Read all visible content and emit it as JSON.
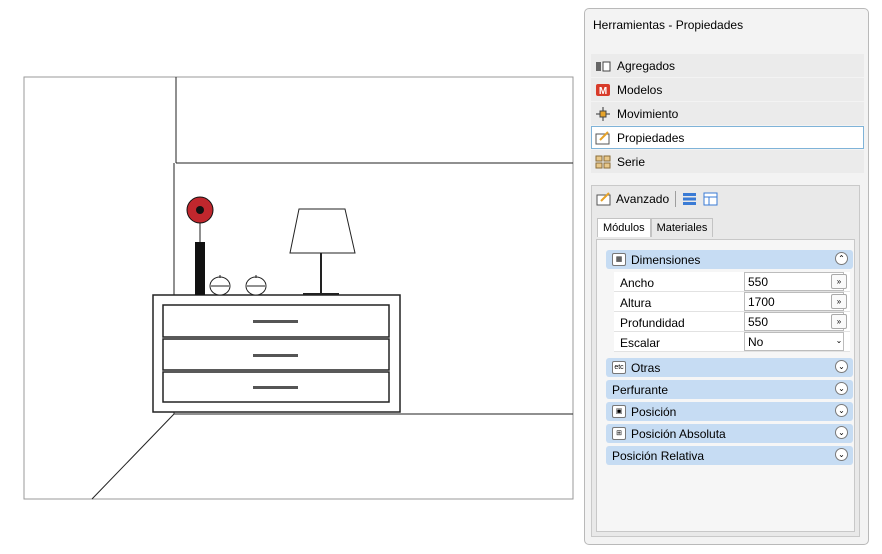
{
  "panel": {
    "title": "Herramientas - Propiedades",
    "nav_items": [
      {
        "label": "Agregados",
        "icon": "aggregates-icon"
      },
      {
        "label": "Modelos",
        "icon": "models-icon"
      },
      {
        "label": "Movimiento",
        "icon": "move-icon"
      },
      {
        "label": "Propiedades",
        "icon": "properties-icon",
        "selected": true
      },
      {
        "label": "Serie",
        "icon": "series-icon"
      }
    ],
    "advanced": {
      "label": "Avanzado",
      "tabs": [
        "Módulos",
        "Materiales"
      ],
      "active_tab": "Módulos",
      "sections": [
        {
          "label": "Dimensiones",
          "expanded": true
        },
        {
          "label": "Otras",
          "expanded": false
        },
        {
          "label": "Perfurante",
          "expanded": false
        },
        {
          "label": "Posición",
          "expanded": false
        },
        {
          "label": "Posición Absoluta",
          "expanded": false
        },
        {
          "label": "Posición Relativa",
          "expanded": false
        }
      ],
      "dimensions": [
        {
          "label": "Ancho",
          "value": "550"
        },
        {
          "label": "Altura",
          "value": "1700"
        },
        {
          "label": "Profundidad",
          "value": "550"
        },
        {
          "label": "Escalar",
          "value": "No"
        }
      ]
    }
  },
  "colors": {
    "section_header": "#c6dcf3",
    "selected_border": "#7fb3d8",
    "flower": "#c0272d"
  }
}
